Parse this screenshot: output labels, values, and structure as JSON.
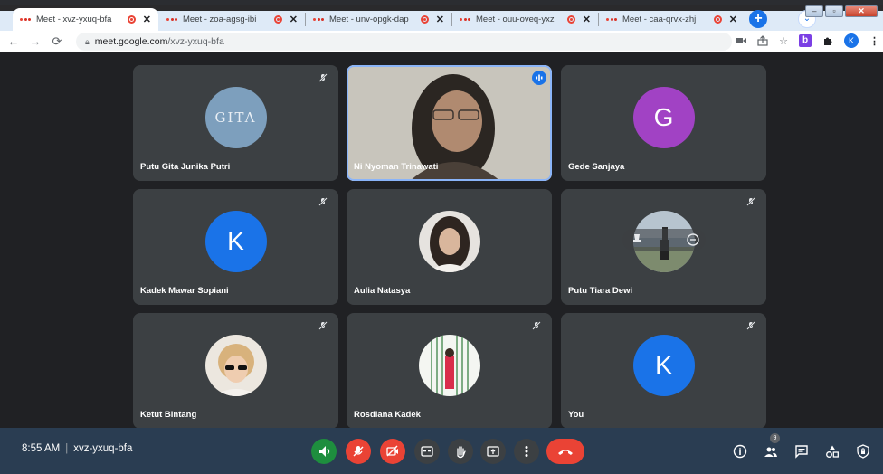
{
  "browser": {
    "tabs": [
      {
        "title": "Meet - xvz-yxuq-bfa",
        "active": true
      },
      {
        "title": "Meet - zoa-agsg-ibi",
        "active": false
      },
      {
        "title": "Meet - unv-opgk-dap",
        "active": false
      },
      {
        "title": "Meet - ouu-oveq-yxz",
        "active": false
      },
      {
        "title": "Meet - caa-qrvx-zhj",
        "active": false
      }
    ],
    "url_host": "meet.google.com",
    "url_path": "/xvz-yxuq-bfa",
    "profile_initial": "K",
    "extension_label": "b"
  },
  "meeting": {
    "time": "8:55 AM",
    "code": "xvz-yxuq-bfa",
    "participant_count": "9"
  },
  "tiles": [
    {
      "name": "Putu Gita Junika Putri",
      "avatar_type": "logo",
      "avatar_text": "GITA",
      "muted": true
    },
    {
      "name": "Ni Nyoman Trinawati",
      "avatar_type": "video",
      "muted": false,
      "speaking": true
    },
    {
      "name": "Gede Sanjaya",
      "avatar_type": "letter",
      "avatar_text": "G",
      "avatar_color": "#a142c4",
      "muted": false
    },
    {
      "name": "Kadek Mawar Sopiani",
      "avatar_type": "letter",
      "avatar_text": "K",
      "avatar_color": "#1a73e8",
      "muted": true
    },
    {
      "name": "Aulia Natasya",
      "avatar_type": "photo",
      "muted": false
    },
    {
      "name": "Putu Tiara Dewi",
      "avatar_type": "photo",
      "muted": true,
      "hover_overlay": true
    },
    {
      "name": "Ketut Bintang",
      "avatar_type": "photo",
      "muted": true
    },
    {
      "name": "Rosdiana Kadek",
      "avatar_type": "photo",
      "muted": true
    },
    {
      "name": "You",
      "avatar_type": "letter",
      "avatar_text": "K",
      "avatar_color": "#1a73e8",
      "muted": true
    }
  ],
  "controls": [
    {
      "name": "speaker-test-button",
      "color": "#1e8e3e"
    },
    {
      "name": "microphone-toggle-button",
      "color": "#ea4335"
    },
    {
      "name": "camera-toggle-button",
      "color": "#ea4335"
    },
    {
      "name": "captions-button",
      "color": "#3c4043"
    },
    {
      "name": "raise-hand-button",
      "color": "#3c4043"
    },
    {
      "name": "present-screen-button",
      "color": "#3c4043"
    },
    {
      "name": "more-options-button",
      "color": "#3c4043"
    },
    {
      "name": "leave-call-button",
      "color": "#ea4335"
    }
  ],
  "colors": {
    "stage_bg": "#202124",
    "tile_bg": "#3c4043",
    "bottom_bar": "#2a3d52",
    "accent": "#1a73e8",
    "danger": "#ea4335",
    "active_speaker_border": "#8ab4f8"
  },
  "icons": {
    "mute": "mic-off-icon",
    "speaking": "audio-level-icon",
    "info": "info-icon",
    "people": "people-icon",
    "chat": "chat-icon",
    "activities": "activities-icon",
    "host_controls": "shield-lock-icon"
  }
}
